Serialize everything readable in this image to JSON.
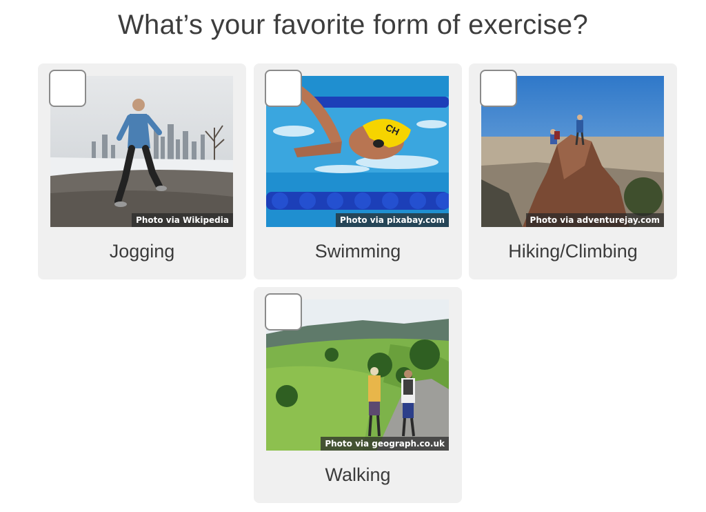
{
  "question": "What’s your favorite form of exercise?",
  "options": [
    {
      "label": "Jogging",
      "credit": "Photo via Wikipedia",
      "checked": false
    },
    {
      "label": "Swimming",
      "credit": "Photo via pixabay.com",
      "checked": false
    },
    {
      "label": "Hiking/Climbing",
      "credit": "Photo via adventurejay.com",
      "checked": false
    },
    {
      "label": "Walking",
      "credit": "Photo via geograph.co.uk",
      "checked": false
    }
  ],
  "colors": {
    "card_bg": "#f0f0f0",
    "text": "#3b3b3b",
    "checkbox_border": "#8a8a8a"
  }
}
